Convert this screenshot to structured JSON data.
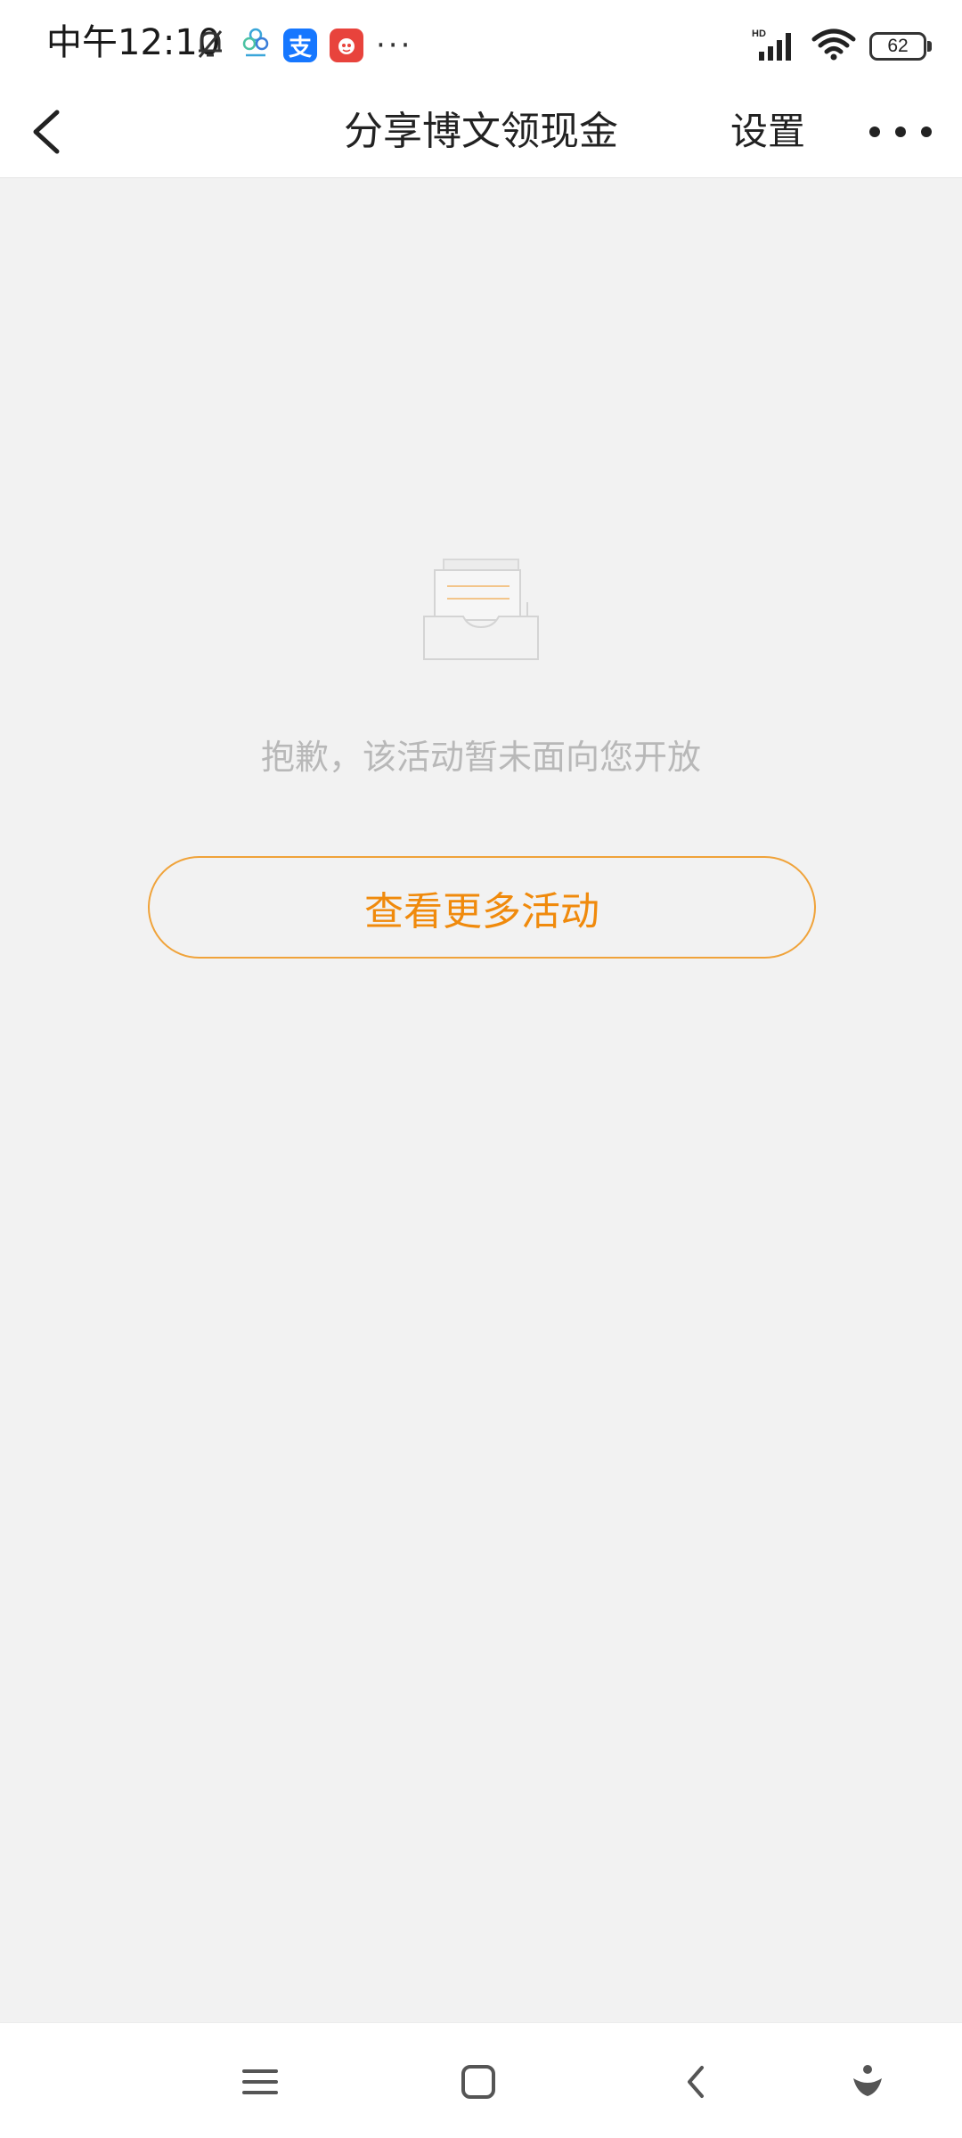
{
  "status_bar": {
    "time": "中午12:10",
    "left_icons": [
      "bell-off-icon",
      "cloud-app-icon",
      "alipay-icon",
      "red-app-icon"
    ],
    "alipay_glyph": "支",
    "more": "···",
    "battery_level": "62"
  },
  "nav": {
    "title": "分享博文领现金",
    "settings_label": "设置"
  },
  "empty_state": {
    "message": "抱歉，该活动暂未面向您开放",
    "button_label": "查看更多活动"
  },
  "colors": {
    "accent": "#f08a0c",
    "background": "#f2f2f2",
    "message": "#b8b8b8"
  }
}
